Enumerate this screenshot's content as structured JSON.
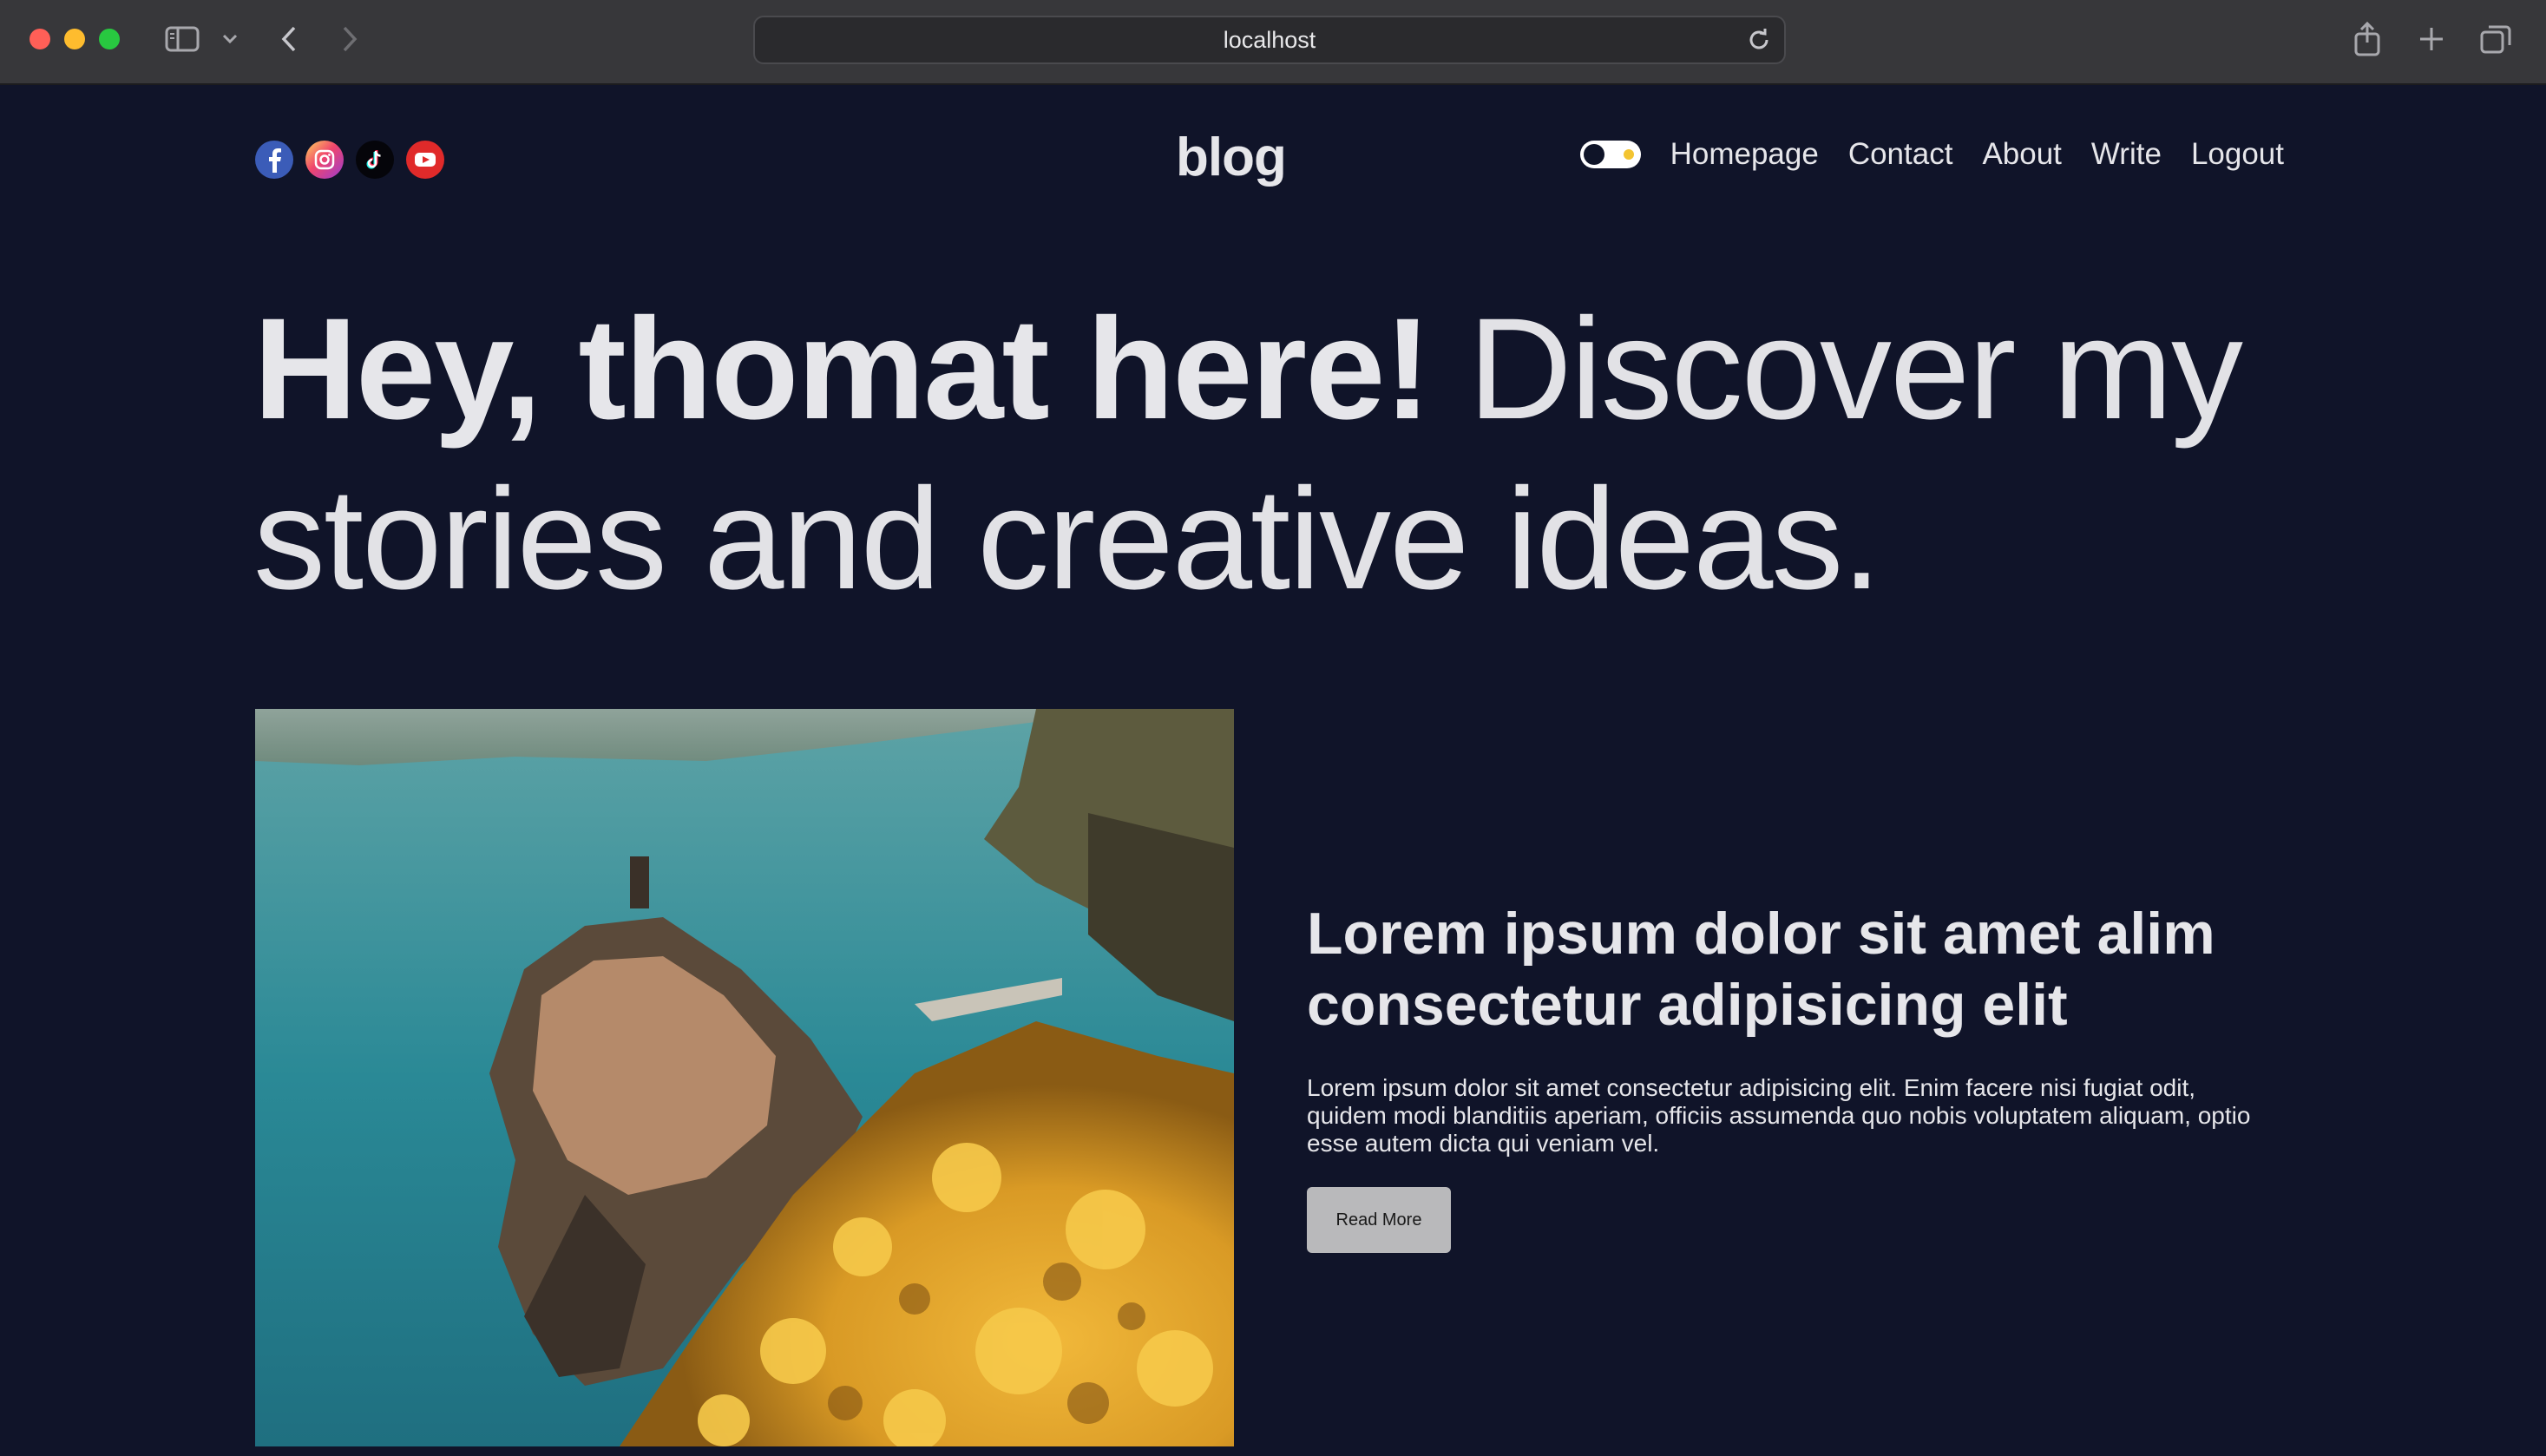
{
  "browser": {
    "url": "localhost",
    "icons": [
      "sidebar-icon",
      "chevron-down-icon",
      "back-icon",
      "forward-icon",
      "reload-icon",
      "share-icon",
      "new-tab-icon",
      "tabs-overview-icon"
    ]
  },
  "header": {
    "logo": "blog",
    "social": [
      "facebook-icon",
      "instagram-icon",
      "tiktok-icon",
      "youtube-icon"
    ],
    "theme_toggle": "dark",
    "nav": [
      "Homepage",
      "Contact",
      "About",
      "Write",
      "Logout"
    ]
  },
  "hero": {
    "bold": "Hey, thomat here!",
    "light": " Discover my stories and creative ideas."
  },
  "featured_post": {
    "image": "coastal-village-photo",
    "title": "Lorem ipsum dolor sit amet alim consectetur adipisicing elit",
    "description": "Lorem ipsum dolor sit amet consectetur adipisicing elit. Enim facere nisi fugiat odit, quidem modi blanditiis aperiam, officiis assumenda quo nobis voluptatem aliquam, optio esse autem dicta qui veniam vel.",
    "button": "Read More"
  },
  "colors": {
    "page_bg": "#101429",
    "text": "#e6e6ea",
    "button_bg": "#b9b9bb"
  }
}
